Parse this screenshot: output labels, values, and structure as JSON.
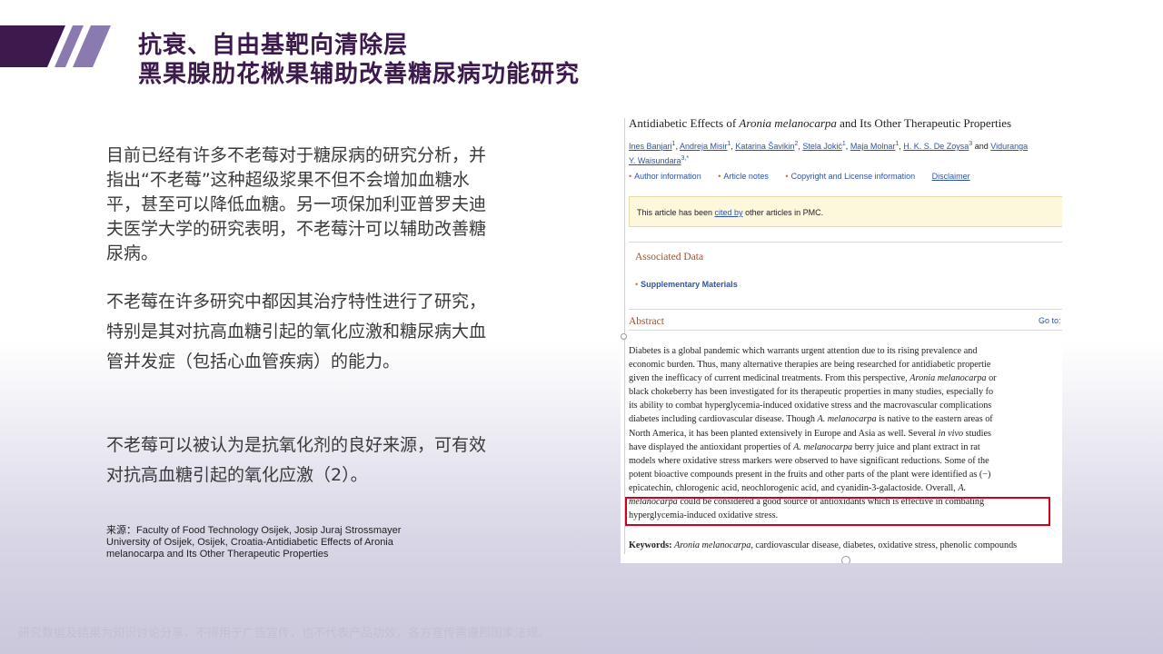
{
  "title": {
    "line1": "抗衰、自由基靶向清除层",
    "line2": "黑果腺肋花楸果辅助改善糖尿病功能研究"
  },
  "paragraphs": {
    "p1": "目前已经有许多不老莓对于糖尿病的研究分析，并指出“不老莓”这种超级浆果不但不会增加血糖水平，甚至可以降低血糖。另一项保加利亚普罗夫迪夫医学大学的研究表明，不老莓汁可以辅助改善糖尿病。",
    "p2": "不老莓在许多研究中都因其治疗特性进行了研究，特别是其对抗高血糖引起的氧化应激和糖尿病大血管并发症（包括心血管疾病）的能力。",
    "p3": "不老莓可以被认为是抗氧化剂的良好来源，可有效对抗高血糖引起的氧化应激（2）。"
  },
  "source_note": "来源：Faculty of Food Technology Osijek, Josip Juraj Strossmayer University of Osijek, Osijek, Croatia-Antidiabetic Effects of Aronia melanocarpa and Its Other Therapeutic Properties",
  "footer_note": "研究数据及结果为知识讨论分享，不得用于广告宣传，也不代表产品功效，各方宣传需遵照国家法规。",
  "article": {
    "title_pre": "Antidiabetic Effects of ",
    "title_italic": "Aronia melanocarpa",
    "title_post": " and Its Other Therapeutic Properties",
    "authors": [
      {
        "name": "Ines Banjari",
        "sup": "1"
      },
      {
        "name": "Andreja Misir",
        "sup": "1"
      },
      {
        "name": "Katarina Šavikin",
        "sup": "2"
      },
      {
        "name": "Stela Jokić",
        "sup": "1"
      },
      {
        "name": "Maja Molnar",
        "sup": "1"
      },
      {
        "name": "H. K. S. De Zoysa",
        "sup": "3"
      },
      {
        "name": "Viduranga Y. Waisundara",
        "sup": "3,*"
      }
    ],
    "authors_and": "and",
    "links": {
      "author_info": "Author information",
      "article_notes": "Article notes",
      "copyright": "Copyright and License information",
      "disclaimer": "Disclaimer"
    },
    "notice_pre": "This article has been ",
    "notice_link": "cited by",
    "notice_post": " other articles in PMC.",
    "associated_data": "Associated Data",
    "supplementary": "Supplementary Materials",
    "abstract_heading": "Abstract",
    "goto": "Go to:",
    "abstract_lines": [
      "Diabetes is a global pandemic which warrants urgent attention due to its rising prevalence and",
      "economic burden. Thus, many alternative therapies are being researched for antidiabetic propertie",
      "given the inefficacy of current medicinal treatments. From this perspective, |Aronia melanocarpa| or",
      "black chokeberry has been investigated for its therapeutic properties in many studies, especially fo",
      "its ability to combat hyperglycemia-induced oxidative stress and the macrovascular complications",
      "diabetes including cardiovascular disease. Though |A. melanocarpa| is native to the eastern areas of",
      "North America, it has been planted extensively in Europe and Asia as well. Several |in vivo| studies",
      "have displayed the antioxidant properties of |A. melanocarpa| berry juice and plant extract in rat",
      "models where oxidative stress markers were observed to have significant reductions. Some of the",
      "potent bioactive compounds present in the fruits and other parts of the plant were identified as (−)",
      "epicatechin, chlorogenic acid, neochlorogenic acid, and cyanidin-3-galactoside. Overall, |A.|",
      "|melanocarpa| could be considered a good source of antioxidants which is effective in combating",
      "hyperglycemia-induced oxidative stress."
    ],
    "keywords_label": "Keywords:",
    "keywords_italic": "Aronia melanocarpa",
    "keywords_rest": ", cardiovascular disease, diabetes, oxidative stress, phenolic compounds"
  },
  "colors": {
    "title": "#3d1a4d",
    "stripe_dark": "#3d1a4d",
    "stripe_light": "#8a7aaf",
    "highlight": "#d0021b"
  }
}
